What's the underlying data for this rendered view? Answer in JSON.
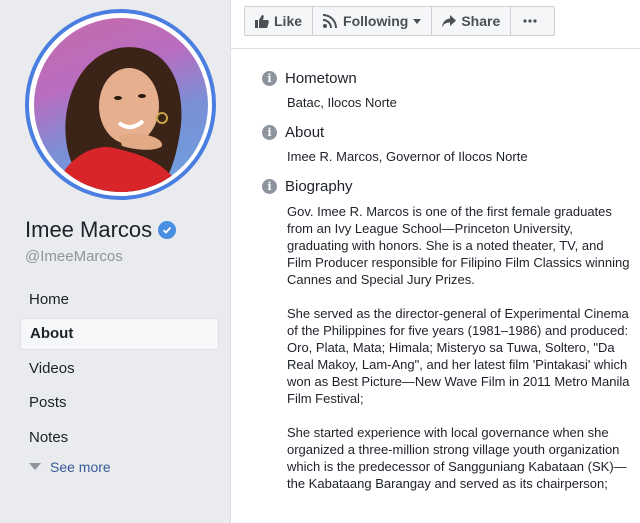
{
  "profile": {
    "name": "Imee Marcos",
    "handle": "@ImeeMarcos"
  },
  "nav": {
    "items": [
      "Home",
      "About",
      "Videos",
      "Posts",
      "Notes"
    ],
    "see_more": "See more"
  },
  "actions": {
    "like": "Like",
    "following": "Following",
    "share": "Share"
  },
  "about": {
    "hometown_title": "Hometown",
    "hometown_value": "Batac, Ilocos Norte",
    "about_title": "About",
    "about_value": "Imee R. Marcos, Governor of Ilocos Norte",
    "bio_title": "Biography",
    "bio_paragraphs": [
      "Gov. Imee R. Marcos is one of the first female graduates from an Ivy League School—Princeton University, graduating with honors. She is a noted theater, TV, and Film Producer responsible for Filipino Film Classics winning Cannes and Special Jury Prizes.",
      "She served as the director-general of Experimental Cinema of the Philippines for five years (1981–1986) and produced: Oro, Plata, Mata; Himala; Misteryo sa Tuwa, Soltero, \"Da Real Makoy, Lam-Ang\", and her latest film 'Pintakasi' which won as Best Picture—New Wave Film in 2011 Metro Manila Film Festival;",
      "She started experience with local governance when she organized a three-million strong village youth organization which is the predecessor of Sangguniang Kabataan (SK)—the Kabataang Barangay and served as its chairperson;"
    ]
  },
  "colors": {
    "accent": "#4a7ee0",
    "link": "#385898",
    "verified": "#4a90e2"
  }
}
